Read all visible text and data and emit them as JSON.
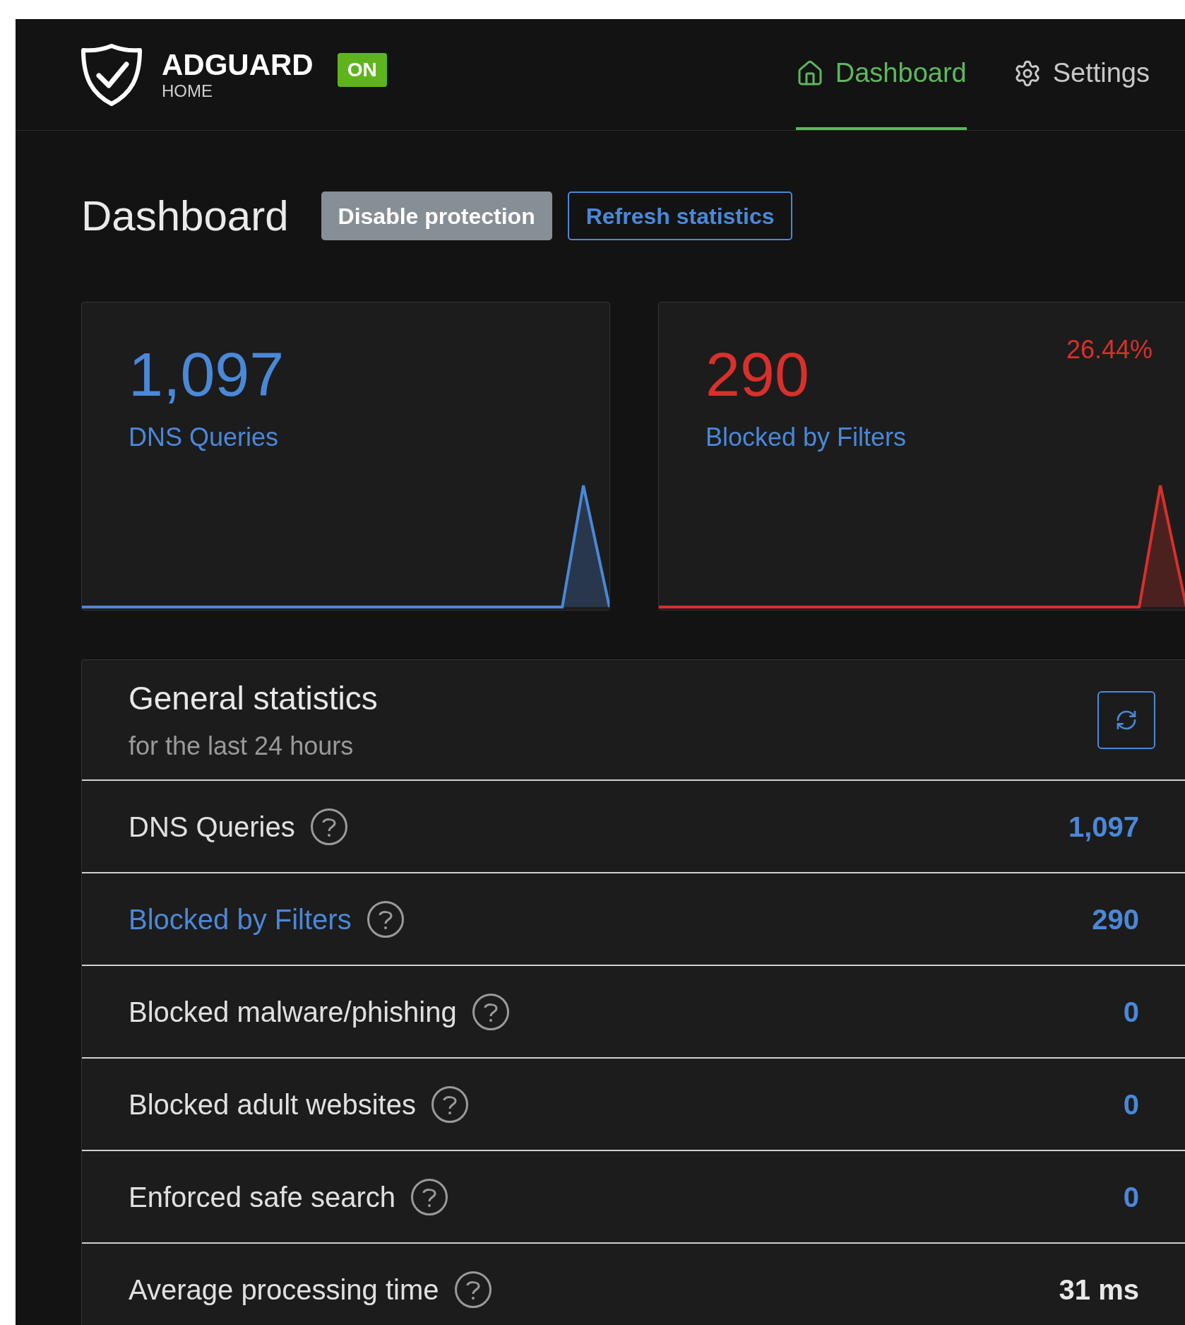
{
  "brand": {
    "name": "ADGUARD",
    "sub": "HOME",
    "badge": "ON",
    "protection_on": true
  },
  "nav": [
    {
      "label": "Dashboard",
      "selected": true
    },
    {
      "label": "Settings",
      "selected": false
    }
  ],
  "page": {
    "title": "Dashboard",
    "buttons": [
      {
        "label": "Disable protection",
        "kind": "secondary"
      },
      {
        "label": "Refresh statistics",
        "kind": "outline"
      }
    ]
  },
  "cards": [
    {
      "value": "1,097",
      "label": "DNS Queries",
      "color": "#4a88d8"
    },
    {
      "value": "290",
      "label": "Blocked by Filters",
      "percent": "26.44%",
      "color": "#d8302b"
    }
  ],
  "stats": {
    "title": "General statistics",
    "subtitle": "for the last 24 hours",
    "rows": [
      {
        "label": "DNS Queries",
        "value": "1,097",
        "label_link": false,
        "value_accent": true
      },
      {
        "label": "Blocked by Filters",
        "value": "290",
        "label_link": true,
        "value_accent": true
      },
      {
        "label": "Blocked malware/phishing",
        "value": "0",
        "label_link": false,
        "value_accent": true
      },
      {
        "label": "Blocked adult websites",
        "value": "0",
        "label_link": false,
        "value_accent": true
      },
      {
        "label": "Enforced safe search",
        "value": "0",
        "label_link": false,
        "value_accent": true
      },
      {
        "label": "Average processing time",
        "value": "31 ms",
        "label_link": false,
        "value_accent": false
      }
    ]
  }
}
